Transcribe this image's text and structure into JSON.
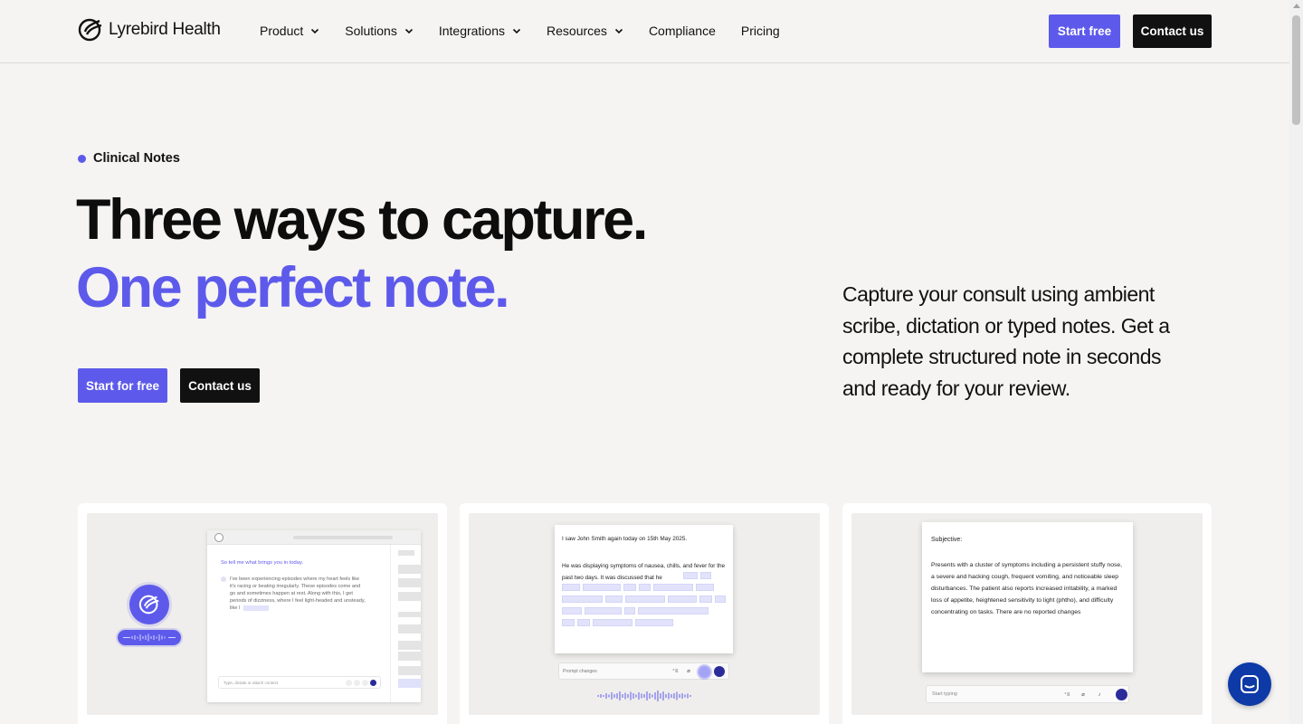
{
  "header": {
    "logo_text": "Lyrebird Health",
    "nav": [
      {
        "label": "Product",
        "has_dropdown": true
      },
      {
        "label": "Solutions",
        "has_dropdown": true
      },
      {
        "label": "Integrations",
        "has_dropdown": true
      },
      {
        "label": "Resources",
        "has_dropdown": true
      },
      {
        "label": "Compliance",
        "has_dropdown": false
      },
      {
        "label": "Pricing",
        "has_dropdown": false
      }
    ],
    "start_label": "Start free",
    "contact_label": "Contact us"
  },
  "hero": {
    "eyebrow": "Clinical Notes",
    "title_line1": "Three ways to capture.",
    "title_line2": "One perfect note.",
    "cta_start": "Start for free",
    "cta_contact": "Contact us",
    "description": "Capture your consult using ambient scribe, dictation or typed notes. Get a complete structured note in seconds and ready for your review."
  },
  "cards": {
    "ambient": {
      "question": "So tell me what brings you in today.",
      "answer": "I've been experiencing episodes where my heart feels like it's racing or beating irregularly. These episodes come and go and sometimes happen at rest. Along with this, I get periods of dizziness, where I feel light-headed and unsteady, like I",
      "input_placeholder": "Type, dictate or attach context"
    },
    "dictation": {
      "line1": "I saw John Smith again today on 15th May 2025.",
      "line2": "He was displaying symptoms of nausea, chills, and fever for the past two days. It was discussed that he",
      "prompt_placeholder": "Prompt changes"
    },
    "typed": {
      "heading": "Subjective:",
      "body": "Presents with a cluster of symptoms including a persistent stuffy nose, a severe and hacking cough, frequent vomiting, and noticeable sleep disturbances. The patient also reports increased irritability, a marked loss of appetite, heightened sensitivity to light (phtho), and difficulty concentrating on tasks. There are no reported changes",
      "input_placeholder": "Start typing"
    }
  },
  "colors": {
    "brand": "#5d5aeb",
    "dark": "#111111",
    "background": "#f5f4f2",
    "chat": "#0e3aa8"
  }
}
